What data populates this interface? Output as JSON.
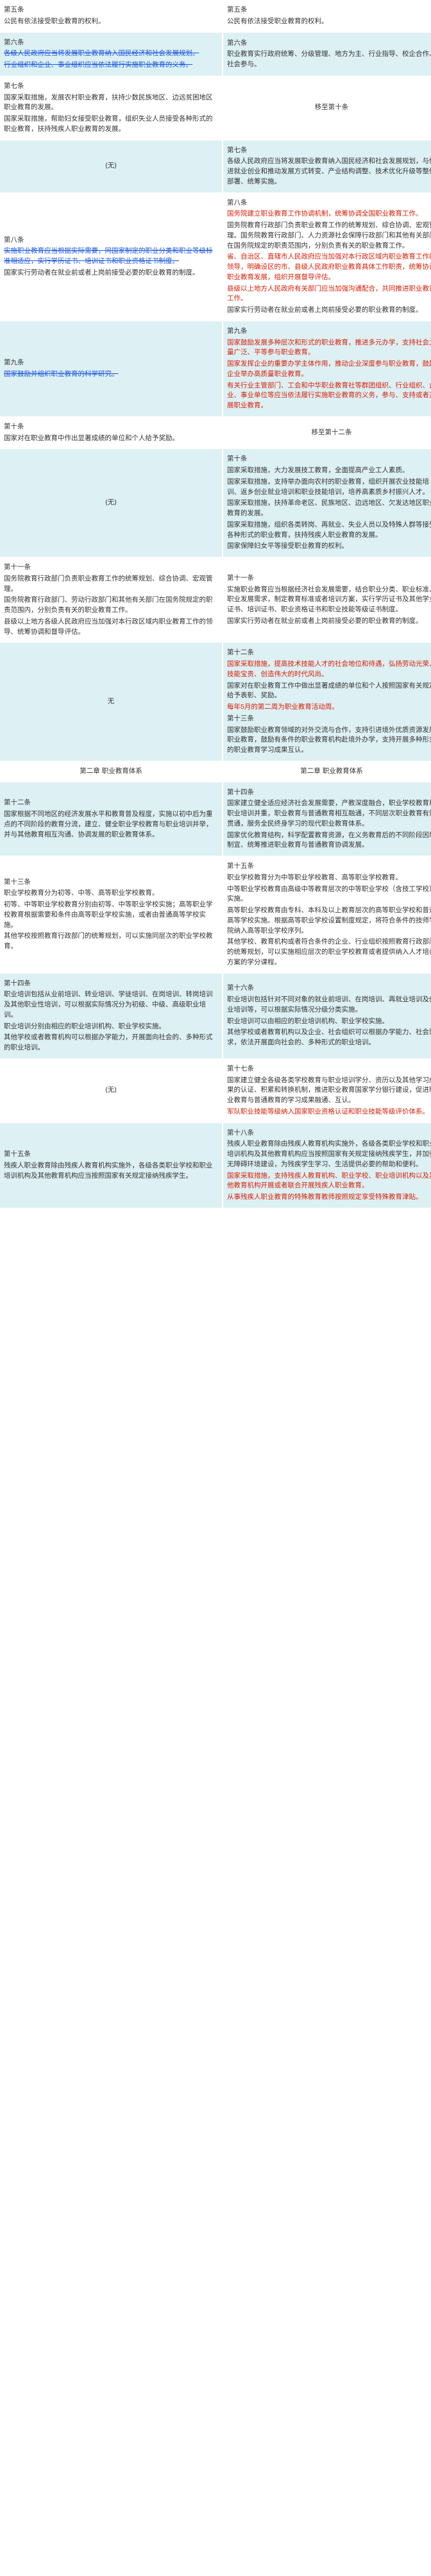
{
  "rows": [
    {
      "left": [
        {
          "style": "plain",
          "text": "第五条"
        },
        {
          "style": "plain",
          "text": "公民有依法接受职业教育的权利。"
        }
      ],
      "right": [
        {
          "style": "plain",
          "text": "第五条"
        },
        {
          "style": "plain",
          "text": "公民有依法接受职业教育的权利。"
        }
      ]
    },
    {
      "left": [
        {
          "style": "plain",
          "text": "第六条"
        },
        {
          "style": "del",
          "text": "各级人民政府应当将发展职业教育纳入国民经济和社会发展规划。"
        },
        {
          "style": "del",
          "text": "行业组织和企业、事业组织应当依法履行实施职业教育的义务。"
        }
      ],
      "right": [
        {
          "style": "plain",
          "text": "第六条"
        },
        {
          "style": "plain",
          "text": "职业教育实行政府统筹、分级管理、地方为主、行业指导、校企合作、社会参与。"
        }
      ]
    },
    {
      "left": [
        {
          "style": "plain",
          "text": "第七条"
        },
        {
          "style": "plain",
          "text": "国家采取措施，发展农村职业教育，扶持少数民族地区、边远贫困地区职业教育的发展。"
        },
        {
          "style": "plain",
          "text": "国家采取措施，帮助妇女接受职业教育，组织失业人员接受各种形式的职业教育，扶持残疾人职业教育的发展。"
        }
      ],
      "right": [
        {
          "style": "center",
          "text": "移至第十条"
        }
      ]
    },
    {
      "left": [
        {
          "style": "center",
          "text": "(无)"
        }
      ],
      "right": [
        {
          "style": "plain",
          "text": "第七条"
        },
        {
          "style": "plain",
          "text": "各级人民政府应当将发展职业教育纳入国民经济和社会发展规划，与促进就业创业和推动发展方式转变、产业结构调整、技术优化升级等整体部署、统筹实施。"
        }
      ]
    },
    {
      "left": [
        {
          "style": "plain",
          "text": "第八条"
        },
        {
          "style": "del",
          "text": "实施职业教育应当根据实际需要，同国家制定的职业分类和职业等级标准相适应，实行学历证书、培训证书和职业资格证书制度。"
        },
        {
          "style": "plain",
          "text": "国家实行劳动者在就业前或者上岗前接受必要的职业教育的制度。"
        }
      ],
      "right": [
        {
          "style": "plain",
          "text": "第八条"
        },
        {
          "style": "red",
          "text": "国务院建立职业教育工作协调机制，统筹协调全国职业教育工作。"
        },
        {
          "style": "plain",
          "text": "国务院教育行政部门负责职业教育工作的统筹规划、综合协调、宏观管理。国务院教育行政部门、人力资源社会保障行政部门和其他有关部门在国务院规定的职责范围内，分别负责有关的职业教育工作。"
        },
        {
          "style": "red",
          "text": "省、自治区、直辖市人民政府应当加强对本行政区域内职业教育工作的领导，明确设区的市、县级人民政府职业教育具体工作职责，统筹协调职业教育发展，组织开展督导评估。"
        },
        {
          "style": "red",
          "text": "县级以上地方人民政府有关部门应当加强沟通配合，共同推进职业教育工作。"
        },
        {
          "style": "plain",
          "text": "国家实行劳动者在就业前或者上岗前接受必要的职业教育的制度。"
        }
      ]
    },
    {
      "left": [
        {
          "style": "plain",
          "text": "第九条"
        },
        {
          "style": "del",
          "text": "国家鼓励并组织职业教育的科学研究。"
        }
      ],
      "right": [
        {
          "style": "plain",
          "text": "第九条"
        },
        {
          "style": "red",
          "text": "国家鼓励发展多种层次和形式的职业教育，推进多元办学，支持社会力量广泛、平等参与职业教育。"
        },
        {
          "style": "red",
          "text": "国家发挥企业的重要办学主体作用，推动企业深度参与职业教育，鼓励企业举办高质量职业教育。"
        },
        {
          "style": "red",
          "text": "有关行业主管部门、工会和中华职业教育社等群团组织、行业组织、企业、事业单位等应当依法履行实施职业教育的义务，参与、支持或者开展职业教育。"
        }
      ]
    },
    {
      "left": [
        {
          "style": "plain",
          "text": "第十条"
        },
        {
          "style": "plain",
          "text": "国家对在职业教育中作出显著成绩的单位和个人给予奖励。"
        }
      ],
      "right": [
        {
          "style": "center",
          "text": "移至第十二条"
        }
      ]
    },
    {
      "left": [
        {
          "style": "center",
          "text": "(无)"
        }
      ],
      "right": [
        {
          "style": "plain",
          "text": "第十条"
        },
        {
          "style": "plain",
          "text": "国家采取措施，大力发展技工教育，全面提高产业工人素质。"
        },
        {
          "style": "plain",
          "text": "国家采取措施，支持举办面向农村的职业教育，组织开展农业技能培训、返乡创业就业培训和职业技能培训，培养高素质乡村振兴人才。"
        },
        {
          "style": "plain",
          "text": "国家采取措施，扶持革命老区、民族地区、边远地区、欠发达地区职业教育的发展。"
        },
        {
          "style": "plain",
          "text": "国家采取措施，组织各类转岗、再就业、失业人员以及特殊人群等接受各种形式的职业教育，扶持残疾人职业教育的发展。"
        },
        {
          "style": "plain",
          "text": "国家保障妇女平等接受职业教育的权利。"
        }
      ]
    },
    {
      "left": [
        {
          "style": "plain",
          "text": "第十一条"
        },
        {
          "style": "plain",
          "text": "国务院教育行政部门负责职业教育工作的统筹规划、综合协调、宏观管理。"
        },
        {
          "style": "plain",
          "text": "国务院教育行政部门、劳动行政部门和其他有关部门在国务院规定的职责范围内，分别负责有关的职业教育工作。"
        },
        {
          "style": "plain",
          "text": "县级以上地方各级人民政府应当加强对本行政区域内职业教育工作的领导、统筹协调和督导评估。"
        }
      ],
      "right": [
        {
          "style": "plain",
          "text": "第十一条"
        },
        {
          "style": "plain",
          "text": "实施职业教育应当根据经济社会发展需要，结合职业分类、职业标准、职业发展需求，制定教育标准或者培训方案，实行学历证书及其他学业证书、培训证书、职业资格证书和职业技能等级证书制度。"
        },
        {
          "style": "plain",
          "text": "国家实行劳动者在就业前或者上岗前接受必要的职业教育的制度。"
        }
      ]
    },
    {
      "left": [
        {
          "style": "center",
          "text": "无"
        }
      ],
      "right": [
        {
          "style": "plain",
          "text": "第十二条"
        },
        {
          "style": "red",
          "text": "国家采取措施，提高技术技能人才的社会地位和待遇，弘扬劳动光荣、技能宝贵、创造伟大的时代风尚。"
        },
        {
          "style": "plain",
          "text": "国家对在职业教育工作中做出显著成绩的单位和个人按照国家有关规定给予表彰、奖励。"
        },
        {
          "style": "red",
          "text": "每年5月的第二周为职业教育活动周。"
        },
        {
          "style": "plain",
          "text": "第十三条"
        },
        {
          "style": "plain",
          "text": "国家鼓励职业教育领域的对外交流与合作，支持引进境外优质资源发展职业教育，鼓励有条件的职业教育机构赴境外办学，支持开展多种形式的职业教育学习成果互认。"
        }
      ]
    },
    {
      "left": [
        {
          "style": "center",
          "text": "第二章 职业教育体系"
        }
      ],
      "right": [
        {
          "style": "center",
          "text": "第二章 职业教育体系"
        }
      ]
    },
    {
      "left": [
        {
          "style": "plain",
          "text": "第十二条"
        },
        {
          "style": "plain",
          "text": "国家根据不同地区的经济发展水平和教育普及程度，实施以初中后为重点的不同阶段的教育分流，建立、健全职业学校教育与职业培训并举，并与其他教育相互沟通、协调发展的职业教育体系。"
        }
      ],
      "right": [
        {
          "style": "plain",
          "text": "第十四条"
        },
        {
          "style": "plain",
          "text": "国家建立健全适应经济社会发展需要，产教深度融合，职业学校教育和职业培训并重，职业教育与普通教育相互融通，不同层次职业教育有效贯通，服务全民终身学习的现代职业教育体系。"
        },
        {
          "style": "plain",
          "text": "国家优化教育结构，科学配置教育资源，在义务教育后的不同阶段因地制宜、统筹推进职业教育与普通教育协调发展。"
        }
      ]
    },
    {
      "left": [
        {
          "style": "plain",
          "text": "第十三条"
        },
        {
          "style": "plain",
          "text": "职业学校教育分为初等、中等、高等职业学校教育。"
        },
        {
          "style": "plain",
          "text": "初等、中等职业学校教育分别由初等、中等职业学校实施；高等职业学校教育根据需要和条件由高等职业学校实施，或者由普通高等学校实施。"
        },
        {
          "style": "plain",
          "text": "其他学校按照教育行政部门的统筹规划，可以实施同层次的职业学校教育。"
        }
      ],
      "right": [
        {
          "style": "plain",
          "text": "第十五条"
        },
        {
          "style": "plain",
          "text": "职业学校教育分为中等职业学校教育、高等职业学校教育。"
        },
        {
          "style": "plain",
          "text": "中等职业学校教育由高级中等教育层次的中等职业学校（含技工学校）实施。"
        },
        {
          "style": "plain",
          "text": "高等职业学校教育由专科、本科及以上教育层次的高等职业学校和普通高等学校实施。根据高等职业学校设置制度规定，将符合条件的技师学院纳入高等职业学校序列。"
        },
        {
          "style": "plain",
          "text": "其他学校、教育机构或者符合条件的企业、行业组织按照教育行政部门的统筹规划，可以实施相应层次的职业学校教育或者提供纳入人才培养方案的学分课程。"
        }
      ]
    },
    {
      "left": [
        {
          "style": "plain",
          "text": "第十四条"
        },
        {
          "style": "plain",
          "text": "职业培训包括从业前培训、转业培训、学徒培训、在岗培训、转岗培训及其他职业性培训，可以根据实际情况分为初级、中级、高级职业培训。"
        },
        {
          "style": "plain",
          "text": "职业培训分别由相应的职业培训机构、职业学校实施。"
        },
        {
          "style": "plain",
          "text": "其他学校或者教育机构可以根据办学能力，开展面向社会的、多种形式的职业培训。"
        }
      ],
      "right": [
        {
          "style": "plain",
          "text": "第十六条"
        },
        {
          "style": "plain",
          "text": "职业培训包括针对不同对象的就业前培训、在岗培训、再就业培训及创业培训等，可以根据实际情况分级分类实施。"
        },
        {
          "style": "plain",
          "text": "职业培训可以由相应的职业培训机构、职业学校实施。"
        },
        {
          "style": "plain",
          "text": "其他学校或者教育机构以及企业、社会组织可以根据办学能力、社会需求，依法开展面向社会的、多种形式的职业培训。"
        }
      ]
    },
    {
      "left": [
        {
          "style": "center",
          "text": "(无)"
        }
      ],
      "right": [
        {
          "style": "plain",
          "text": "第十七条"
        },
        {
          "style": "plain",
          "text": "国家建立健全各级各类学校教育与职业培训学分、资历以及其他学习成果的认证、积累和转换机制，推进职业教育国家学分银行建设，促进职业教育与普通教育的学习成果融通、互认。"
        },
        {
          "style": "red",
          "text": "军队职业技能等级纳入国家职业资格认证和职业技能等级评价体系。"
        }
      ]
    },
    {
      "left": [
        {
          "style": "plain",
          "text": "第十五条"
        },
        {
          "style": "plain",
          "text": "残疾人职业教育除由残疾人教育机构实施外，各级各类职业学校和职业培训机构及其他教育机构应当按照国家有关规定接纳残疾学生。"
        }
      ],
      "right": [
        {
          "style": "plain",
          "text": "第十八条"
        },
        {
          "style": "plain",
          "text": "残疾人职业教育除由残疾人教育机构实施外，各级各类职业学校和职业培训机构及其他教育机构应当按照国家有关规定接纳残疾学生，并加强无障碍环境建设，为残疾学生学习、生活提供必要的帮助和便利。"
        },
        {
          "style": "red",
          "text": "国家采取措施，支持残疾人教育机构、职业学校、职业培训机构以及其他教育机构开展或者联合开展残疾人职业教育。"
        },
        {
          "style": "red",
          "text": "从事残疾人职业教育的特殊教育教师按照规定享受特殊教育津贴。"
        }
      ]
    }
  ]
}
